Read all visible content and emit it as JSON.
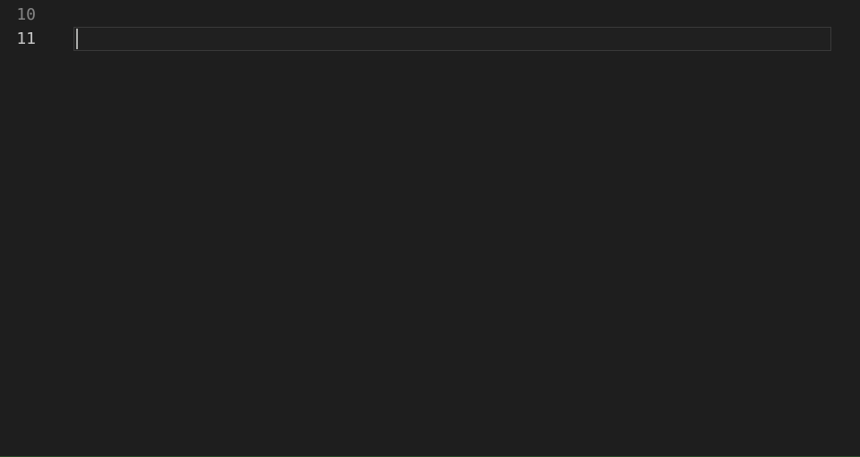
{
  "editor": {
    "lines": [
      {
        "number": "10",
        "active": false,
        "content": ""
      },
      {
        "number": "11",
        "active": true,
        "content": ""
      }
    ]
  }
}
